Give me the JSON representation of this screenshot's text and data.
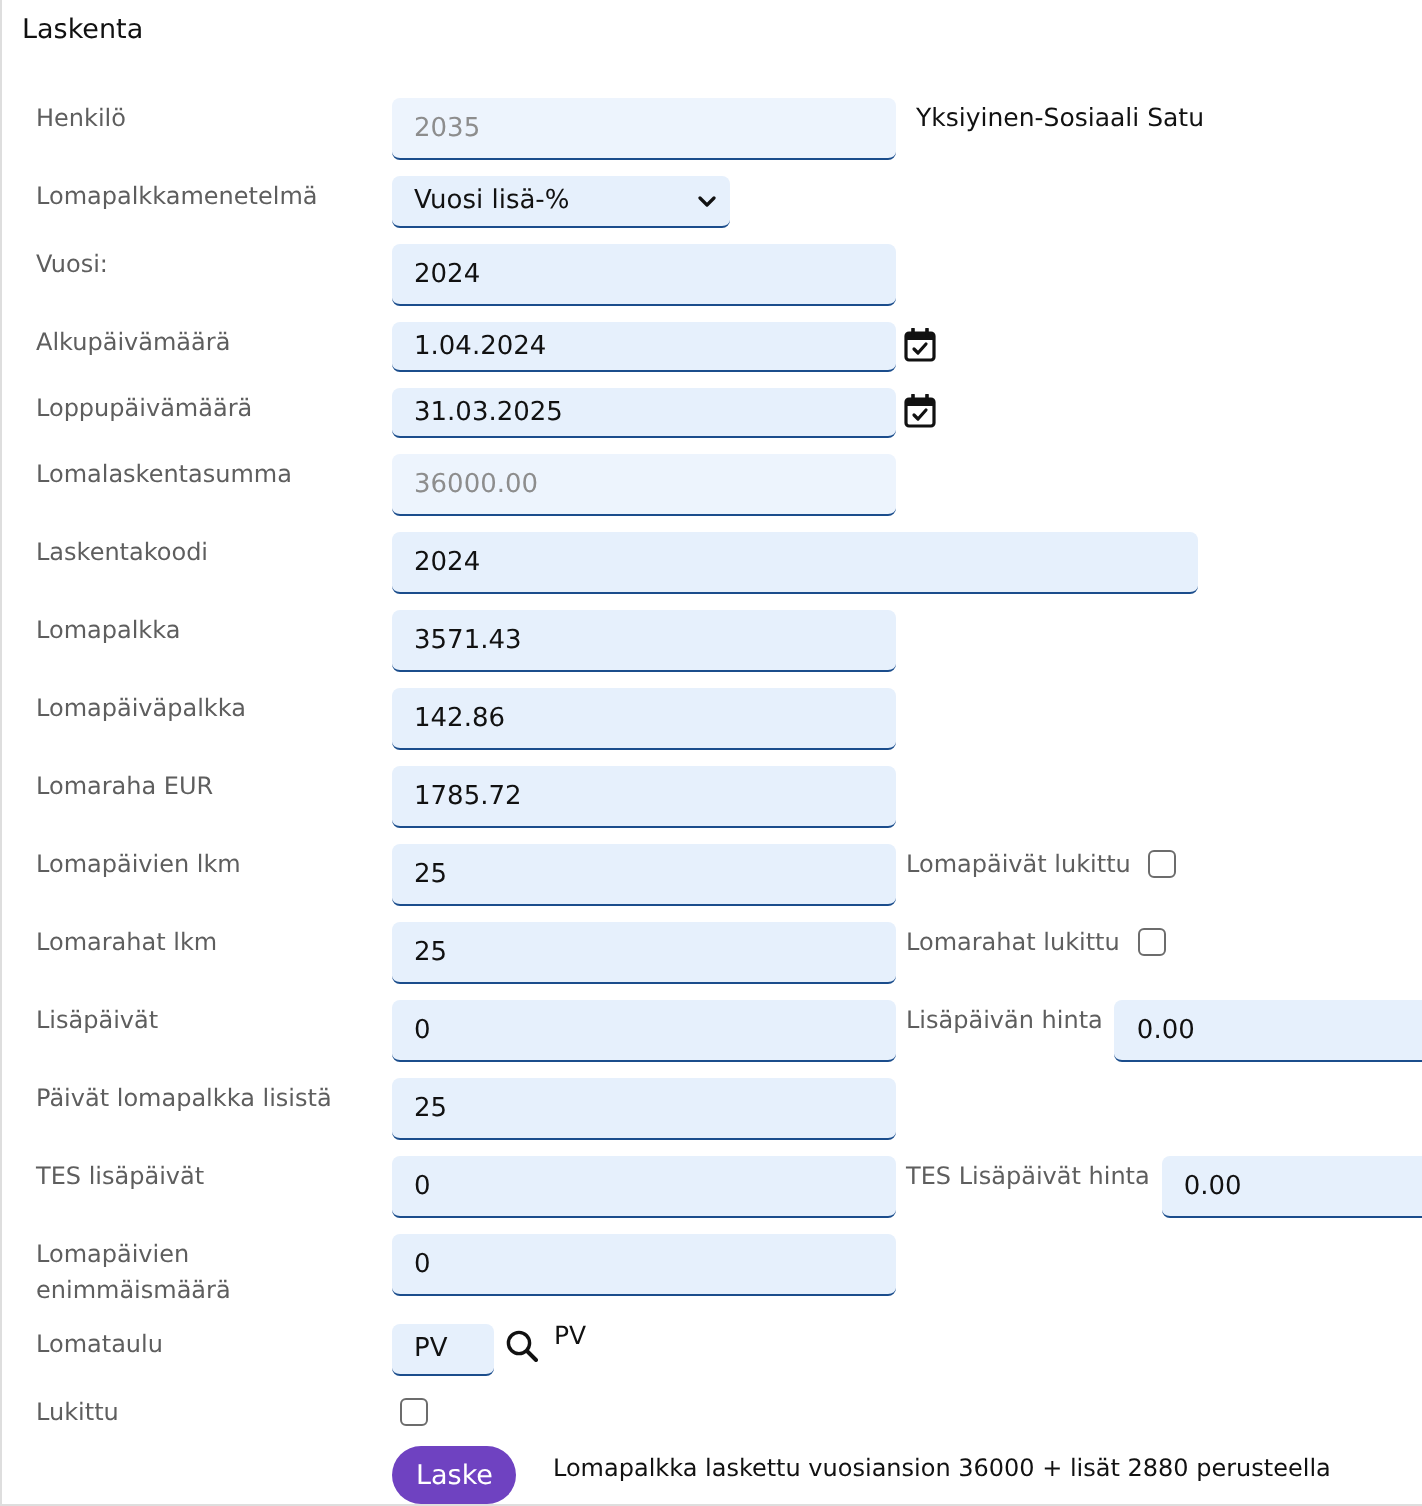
{
  "panel": {
    "title": "Laskenta"
  },
  "rows": [
    {
      "label": "Henkilö",
      "kind": "text",
      "value": "2035",
      "disabled": true,
      "side": {
        "kind": "note",
        "text": "Yksiyinen-Sosiaali Satu"
      }
    },
    {
      "label": "Lomapalkkamenetelmä",
      "kind": "select",
      "value": "Vuosi lisä-%",
      "disabled": false
    },
    {
      "label": "Vuosi:",
      "kind": "text",
      "value": "2024",
      "disabled": false
    },
    {
      "label": "Alkupäivämäärä",
      "kind": "date",
      "value": "1.04.2024",
      "disabled": false
    },
    {
      "label": "Loppupäivämäärä",
      "kind": "date",
      "value": "31.03.2025",
      "disabled": false
    },
    {
      "label": "Lomalaskentasumma",
      "kind": "text",
      "value": "36000.00",
      "disabled": true
    },
    {
      "label": "Laskentakoodi",
      "kind": "wide",
      "value": "2024",
      "disabled": false
    },
    {
      "label": "Lomapalkka",
      "kind": "text",
      "value": "3571.43",
      "disabled": false
    },
    {
      "label": "Lomapäiväpalkka",
      "kind": "text",
      "value": "142.86",
      "disabled": false
    },
    {
      "label": "Lomaraha EUR",
      "kind": "text",
      "value": "1785.72",
      "disabled": false
    },
    {
      "label": "Lomapäivien lkm",
      "kind": "text",
      "value": "25",
      "disabled": false,
      "side": {
        "kind": "checkbox",
        "label": "Lomapäivät lukittu",
        "checked": false
      }
    },
    {
      "label": "Lomarahat lkm",
      "kind": "text",
      "value": "25",
      "disabled": false,
      "side": {
        "kind": "checkbox",
        "label": "Lomarahat lukittu",
        "checked": false
      }
    },
    {
      "label": "Lisäpäivät",
      "kind": "text",
      "value": "0",
      "disabled": false,
      "side": {
        "kind": "field",
        "label": "Lisäpäivän hinta",
        "value": "0.00"
      }
    },
    {
      "label": "Päivät lomapalkka lisistä",
      "kind": "text",
      "value": "25",
      "disabled": false
    },
    {
      "label": "TES lisäpäivät",
      "kind": "text",
      "value": "0",
      "disabled": false,
      "side": {
        "kind": "field",
        "label": "TES Lisäpäivät hinta",
        "value": "0.00"
      }
    },
    {
      "label": "Lomapäivien enimmäismäärä",
      "kind": "text",
      "value": "0",
      "disabled": false
    },
    {
      "label": "Lomataulu",
      "kind": "lookup",
      "value": "PV",
      "disabled": false,
      "side": {
        "kind": "note",
        "text": "PV"
      }
    },
    {
      "label": "Lukittu",
      "kind": "checkbox",
      "checked": false
    },
    {
      "kind": "action",
      "button": "Laske",
      "message": "Lomapalkka laskettu vuosiansion 36000 + lisät 2880 perusteella"
    }
  ]
}
